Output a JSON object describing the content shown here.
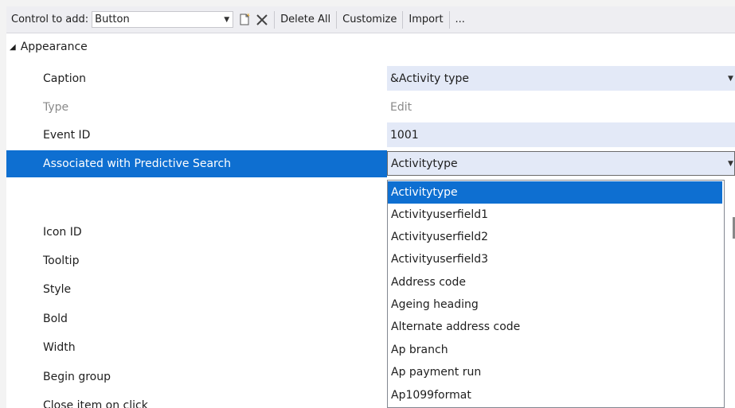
{
  "toolbar": {
    "control_label": "Control to add:",
    "control_value": "Button",
    "delete_all": "Delete All",
    "customize": "Customize",
    "import": "Import",
    "more": "..."
  },
  "group": {
    "label": "Appearance"
  },
  "properties": {
    "caption": {
      "name": "Caption",
      "value": "&Activity type"
    },
    "type": {
      "name": "Type",
      "value": "Edit"
    },
    "event_id": {
      "name": "Event ID",
      "value": "1001"
    },
    "assoc": {
      "name": "Associated with Predictive Search",
      "value": "Activitytype"
    },
    "icon_id": {
      "name": "Icon ID"
    },
    "tooltip": {
      "name": "Tooltip"
    },
    "style": {
      "name": "Style"
    },
    "bold": {
      "name": "Bold"
    },
    "width": {
      "name": "Width"
    },
    "begin_group": {
      "name": "Begin group"
    },
    "close_item": {
      "name": "Close item on click"
    }
  },
  "dropdown": {
    "items": [
      "Activitytype",
      "Activityuserfield1",
      "Activityuserfield2",
      "Activityuserfield3",
      "Address code",
      "Ageing heading",
      "Alternate address code",
      "Ap branch",
      "Ap payment run",
      "Ap1099format"
    ]
  },
  "colors": {
    "selection": "#0e6fd1",
    "value_bg": "#e3e9f7"
  }
}
